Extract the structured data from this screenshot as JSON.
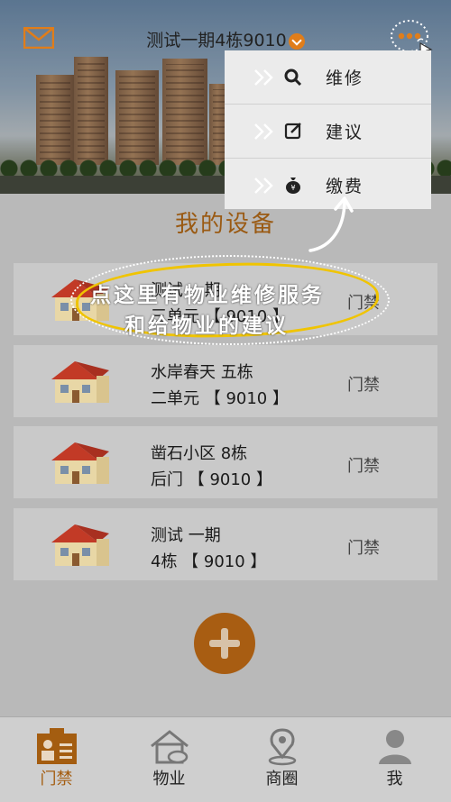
{
  "header": {
    "title": "测试一期4栋9010",
    "icons": {
      "mail": "mail-icon",
      "dropdown": "chevron-down-icon",
      "more": "more-dots-icon"
    },
    "accent_color": "#e07d1a"
  },
  "menu": {
    "items": [
      {
        "label": "维修",
        "icon": "wrench-icon"
      },
      {
        "label": "建议",
        "icon": "edit-icon"
      },
      {
        "label": "缴费",
        "icon": "money-bag-icon"
      }
    ]
  },
  "section": {
    "title": "我的设备"
  },
  "devices": [
    {
      "line1": "测试  一期",
      "line2": "三单元  【 9010 】",
      "tag": "门禁"
    },
    {
      "line1": "水岸春天  五栋",
      "line2": "二单元  【 9010 】",
      "tag": "门禁"
    },
    {
      "line1": "凿石小区  8栋",
      "line2": "后门  【 9010 】",
      "tag": "门禁"
    },
    {
      "line1": "测试  一期",
      "line2": "4栋  【 9010 】",
      "tag": "门禁"
    }
  ],
  "annotation": {
    "line1": "点这里有物业维修服务",
    "line2": "和给物业的建议"
  },
  "tabs": [
    {
      "label": "门禁",
      "icon": "id-card-icon",
      "active": true
    },
    {
      "label": "物业",
      "icon": "house-icon",
      "active": false
    },
    {
      "label": "商圈",
      "icon": "location-pin-icon",
      "active": false
    },
    {
      "label": "我",
      "icon": "user-icon",
      "active": false
    }
  ],
  "colors": {
    "tab_active": "#a45d10",
    "highlight_ring": "#f0c400",
    "section_title": "#9a5a13"
  }
}
